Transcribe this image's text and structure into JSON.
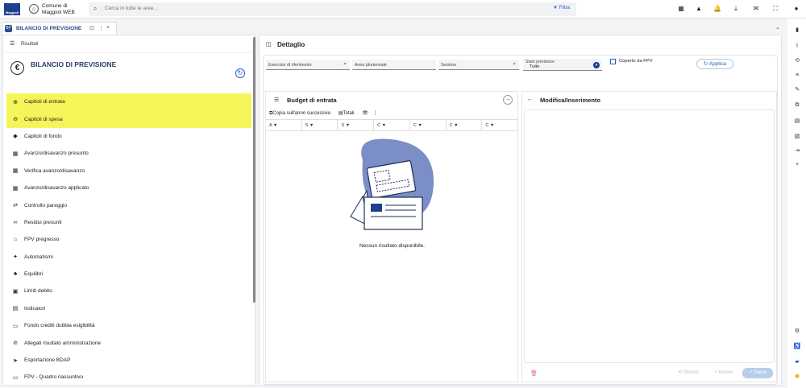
{
  "topbar": {
    "logo_text": "Maggioli",
    "municipality_line1": "Comune di",
    "municipality_line2": "Maggioli WEB",
    "search_placeholder": "Cerca in tutte le aree...",
    "filter_label": "Filtra",
    "icons": [
      {
        "name": "dashboard-icon",
        "glyph": "▦"
      },
      {
        "name": "warning-icon",
        "glyph": "▲",
        "badge": "1"
      },
      {
        "name": "bell-icon",
        "glyph": "🔔",
        "badge": "1"
      },
      {
        "name": "download-icon",
        "glyph": "⤓",
        "badge": "3"
      },
      {
        "name": "mail-icon",
        "glyph": "✉"
      },
      {
        "name": "fullscreen-icon",
        "glyph": "⛶"
      },
      {
        "name": "user-icon",
        "glyph": "●"
      }
    ]
  },
  "tab": {
    "icon": "BP",
    "label": "BILANCIO DI PREVISIONE",
    "pin": "⊡",
    "more": "⋮",
    "close": "×"
  },
  "left": {
    "header_label": "Risultati",
    "card_title": "BILANCIO DI PREVISIONE",
    "card_icon": "€",
    "menu": [
      {
        "label": "Capitoli di entrata",
        "icon": "⊕",
        "icon_name": "plus-circle-icon",
        "highlighted": true
      },
      {
        "label": "Capitoli di spesa",
        "icon": "⊖",
        "icon_name": "minus-circle-icon",
        "highlighted": true
      },
      {
        "label": "Capitoli di fondo",
        "icon": "◆",
        "icon_name": "piggy-bank-icon"
      },
      {
        "label": "Avanzo/disavanzo presunto",
        "icon": "▦",
        "icon_name": "table-icon"
      },
      {
        "label": "Verifica avanzo/disavanzo",
        "icon": "▦",
        "icon_name": "table-check-icon"
      },
      {
        "label": "Avanzo/disavanzo applicato",
        "icon": "▦",
        "icon_name": "table-applied-icon"
      },
      {
        "label": "Controllo pareggio",
        "icon": "⇄",
        "icon_name": "balance-icon"
      },
      {
        "label": "Residui presunti",
        "icon": "∞",
        "icon_name": "infinity-icon"
      },
      {
        "label": "FPV pregresso",
        "icon": "⌂",
        "icon_name": "bank-icon"
      },
      {
        "label": "Automatismi",
        "icon": "✦",
        "icon_name": "magic-wand-icon"
      },
      {
        "label": "Equilibri",
        "icon": "♣",
        "icon_name": "equilibrium-icon"
      },
      {
        "label": "Limiti debito",
        "icon": "▣",
        "icon_name": "limit-icon"
      },
      {
        "label": "Indicatori",
        "icon": "▤",
        "icon_name": "document-chart-icon"
      },
      {
        "label": "Fondo crediti dubbia esigibilità",
        "icon": "▭",
        "icon_name": "credit-card-icon"
      },
      {
        "label": "Allegati risultato amministrazione",
        "icon": "⊘",
        "icon_name": "paperclip-icon"
      },
      {
        "label": "Esportazione BDAP",
        "icon": "➤",
        "icon_name": "send-icon"
      },
      {
        "label": "FPV - Quadro riassuntivo",
        "icon": "▭",
        "icon_name": "summary-icon"
      }
    ]
  },
  "right": {
    "header_title": "Dettaglio",
    "filters": {
      "esercizio": "Esercizio di riferimento",
      "anno": "Anno pluriennale",
      "sezione": "Sezione",
      "stato_label": "Stato previsione",
      "stato_value": "Tutte",
      "coperto": "Coperto da FPV",
      "applica": "Applica"
    },
    "budget": {
      "title": "Budget di entrata",
      "copy_button": "Copia sull'anno successivo",
      "totals_button": "Totali",
      "columns": [
        "A",
        "S",
        "S",
        "C",
        "C",
        "C",
        "C"
      ],
      "empty_text": "Nessun risultato disponibile."
    },
    "modifica": {
      "title": "Modifica/Inserimento",
      "storico": "Storico",
      "nuovo": "+ Nuovo",
      "salva": "✓ Salva"
    }
  },
  "colors": {
    "highlight": "#f5f55a",
    "primary": "#1a62b8",
    "brand": "#1e3f8f"
  }
}
